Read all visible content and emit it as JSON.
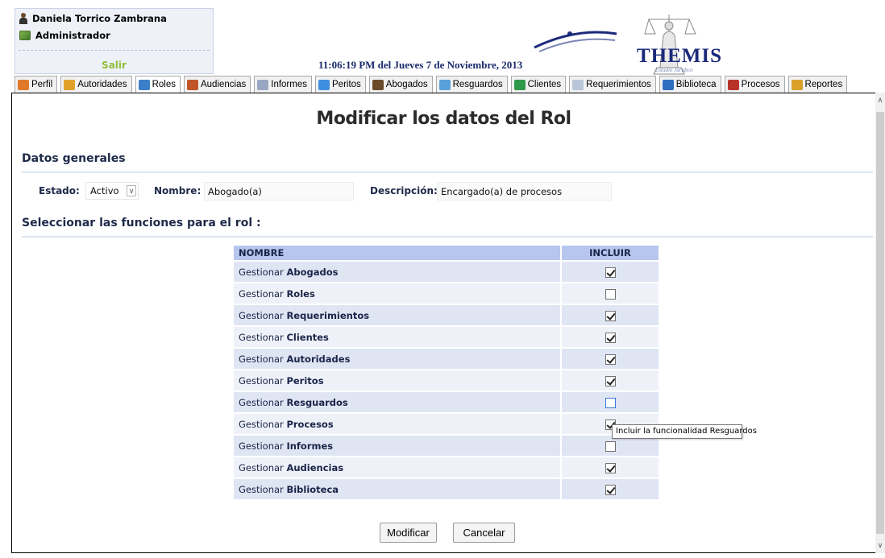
{
  "header": {
    "user_name": "Daniela Torrico Zambrana",
    "user_role": "Administrador",
    "logout_label": "Salir",
    "datetime": "11:06:19 PM del Jueves 7 de Noviembre, 2013",
    "logo_text": "THEMIS",
    "logo_subtext": "Estudio Jurídico"
  },
  "tabs": [
    {
      "label": "Perfil",
      "icon": "profile-icon",
      "color": "#e07a2a"
    },
    {
      "label": "Autoridades",
      "icon": "authorities-icon",
      "color": "#e0a12a"
    },
    {
      "label": "Roles",
      "icon": "roles-icon",
      "color": "#3a7fc8"
    },
    {
      "label": "Audiencias",
      "icon": "hearings-icon",
      "color": "#c0552a"
    },
    {
      "label": "Informes",
      "icon": "reports-icon",
      "color": "#9aa7c2"
    },
    {
      "label": "Peritos",
      "icon": "experts-icon",
      "color": "#3f8fe0"
    },
    {
      "label": "Abogados",
      "icon": "lawyers-icon",
      "color": "#6b4b2a"
    },
    {
      "label": "Resguardos",
      "icon": "safeguards-icon",
      "color": "#5aa0d8"
    },
    {
      "label": "Clientes",
      "icon": "clients-icon",
      "color": "#2f9a4a"
    },
    {
      "label": "Requerimientos",
      "icon": "requirements-icon",
      "color": "#b9c6d9"
    },
    {
      "label": "Biblioteca",
      "icon": "library-icon",
      "color": "#2f6fc0"
    },
    {
      "label": "Procesos",
      "icon": "processes-icon",
      "color": "#b8322a"
    },
    {
      "label": "Reportes",
      "icon": "reports-chart-icon",
      "color": "#d9a02a"
    }
  ],
  "active_tab": "Roles",
  "page": {
    "title": "Modificar los datos del Rol",
    "section_general": "Datos generales",
    "section_functions": "Seleccionar las funciones para el rol :"
  },
  "form": {
    "estado_label": "Estado:",
    "estado_value": "Activo",
    "nombre_label": "Nombre:",
    "nombre_value": "Abogado(a)",
    "descripcion_label": "Descripción:",
    "descripcion_value": "Encargado(a) de procesos"
  },
  "table": {
    "col_name": "NOMBRE",
    "col_include": "INCLUIR",
    "rows": [
      {
        "prefix": "Gestionar",
        "name": "Abogados",
        "checked": true
      },
      {
        "prefix": "Gestionar",
        "name": "Roles",
        "checked": false
      },
      {
        "prefix": "Gestionar",
        "name": "Requerimientos",
        "checked": true
      },
      {
        "prefix": "Gestionar",
        "name": "Clientes",
        "checked": true
      },
      {
        "prefix": "Gestionar",
        "name": "Autoridades",
        "checked": true
      },
      {
        "prefix": "Gestionar",
        "name": "Peritos",
        "checked": true
      },
      {
        "prefix": "Gestionar",
        "name": "Resguardos",
        "checked": false
      },
      {
        "prefix": "Gestionar",
        "name": "Procesos",
        "checked": true
      },
      {
        "prefix": "Gestionar",
        "name": "Informes",
        "checked": false
      },
      {
        "prefix": "Gestionar",
        "name": "Audiencias",
        "checked": true
      },
      {
        "prefix": "Gestionar",
        "name": "Biblioteca",
        "checked": true
      }
    ]
  },
  "tooltip": "Incluir la funcionalidad Resguardos",
  "buttons": {
    "modify": "Modificar",
    "cancel": "Cancelar"
  },
  "colors": {
    "header_blue": "#1b2a7a",
    "logout_green": "#8fbf3a",
    "table_header": "#b7c6ee"
  }
}
